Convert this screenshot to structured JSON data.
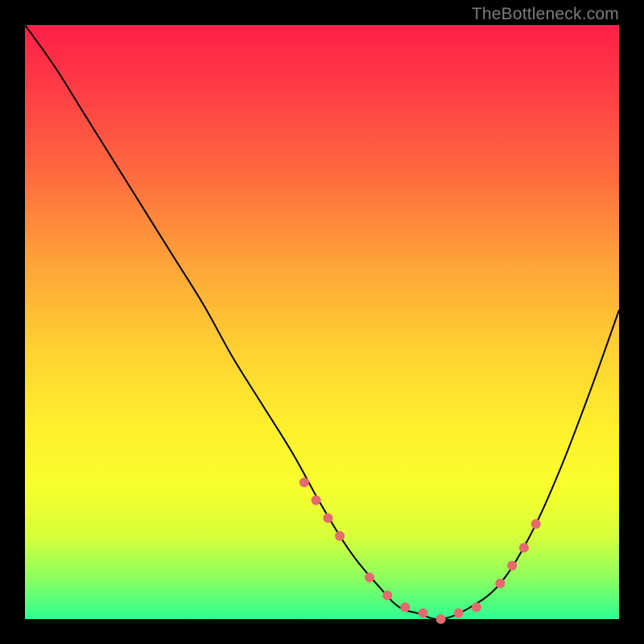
{
  "watermark": {
    "text": "TheBottleneck.com"
  },
  "chart_data": {
    "type": "line",
    "title": "",
    "xlabel": "",
    "ylabel": "",
    "xlim": [
      0,
      100
    ],
    "ylim": [
      0,
      100
    ],
    "series": [
      {
        "name": "bottleneck-curve",
        "x": [
          0,
          5,
          10,
          15,
          20,
          25,
          30,
          35,
          40,
          45,
          50,
          55,
          60,
          63,
          66,
          70,
          75,
          80,
          85,
          90,
          95,
          100
        ],
        "values": [
          100,
          93,
          85,
          77,
          69,
          61,
          53,
          44,
          36,
          28,
          19,
          11,
          5,
          2,
          1,
          0,
          2,
          6,
          14,
          25,
          38,
          52
        ]
      }
    ],
    "markers": {
      "name": "highlight-points",
      "x": [
        47,
        49,
        51,
        53,
        58,
        61,
        64,
        67,
        70,
        73,
        76,
        80,
        82,
        84,
        86
      ],
      "values": [
        23,
        20,
        17,
        14,
        7,
        4,
        2,
        1,
        0,
        1,
        2,
        6,
        9,
        12,
        16
      ],
      "color": "#e46a70",
      "radius_px": 6
    },
    "curve_stroke_px": 2,
    "curve_color": "#000000"
  }
}
